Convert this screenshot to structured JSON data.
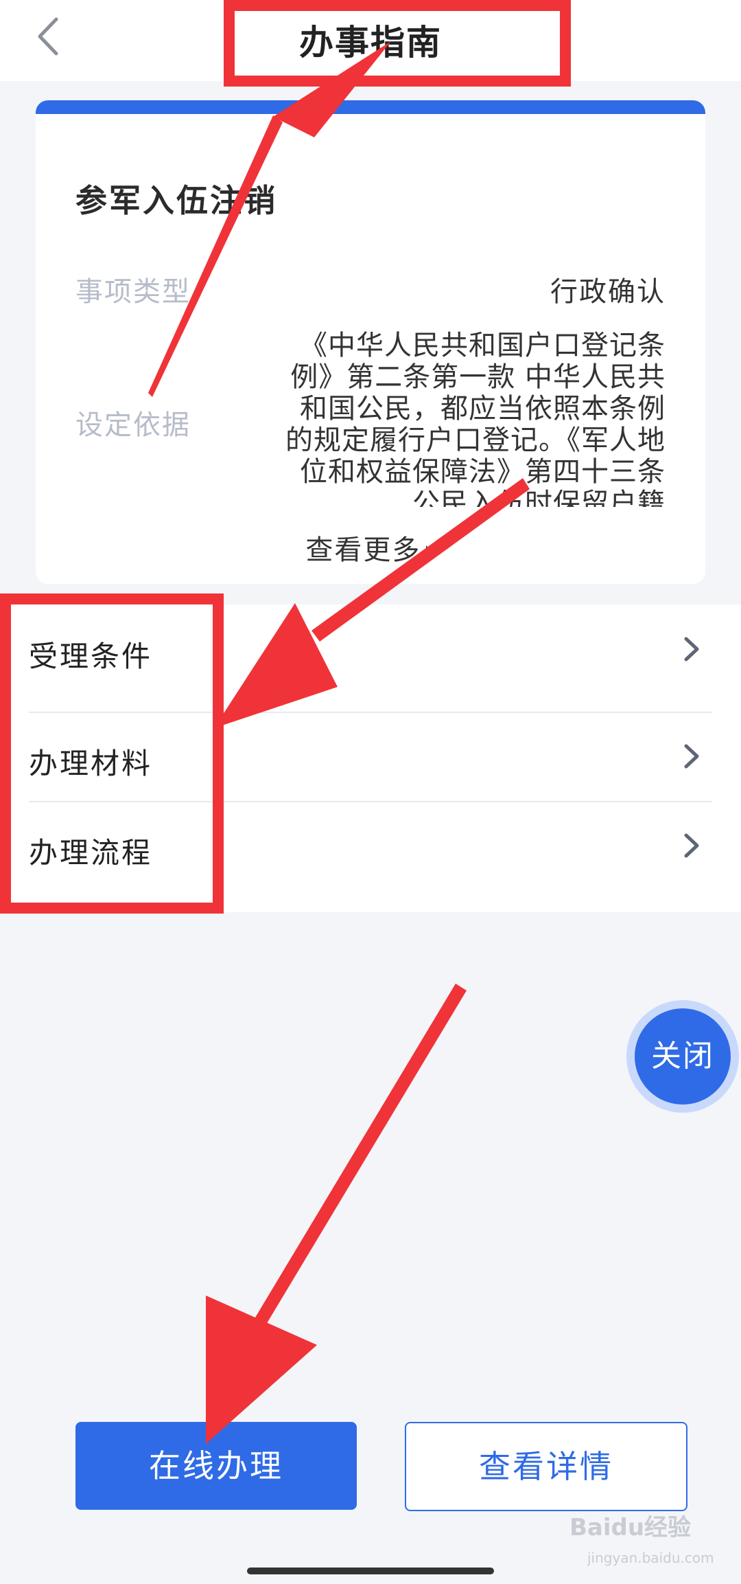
{
  "header": {
    "title": "办事指南"
  },
  "card": {
    "title": "参军入伍注销",
    "type_label": "事项类型",
    "type_value": "行政确认",
    "basis_label": "设定依据",
    "basis_text": "《中华人民共和国户口登记条例》第二条第一款 中华人民共和国公民，都应当依照本条例的规定履行户口登记。《军人地位和权益保障法》第四十三条 公民入伍时保留户籍",
    "more_label": "查看更多"
  },
  "menu": {
    "items": [
      {
        "label": "受理条件"
      },
      {
        "label": "办理材料"
      },
      {
        "label": "办理流程"
      }
    ]
  },
  "fab": {
    "label": "关闭"
  },
  "footer": {
    "primary_label": "在线办理",
    "secondary_label": "查看详情"
  },
  "watermark": {
    "brand": "Baidu经验",
    "url": "jingyan.baidu.com"
  },
  "colors": {
    "accent": "#2f6be6",
    "annotation_red": "#f03338",
    "background": "#f3f5f9"
  }
}
